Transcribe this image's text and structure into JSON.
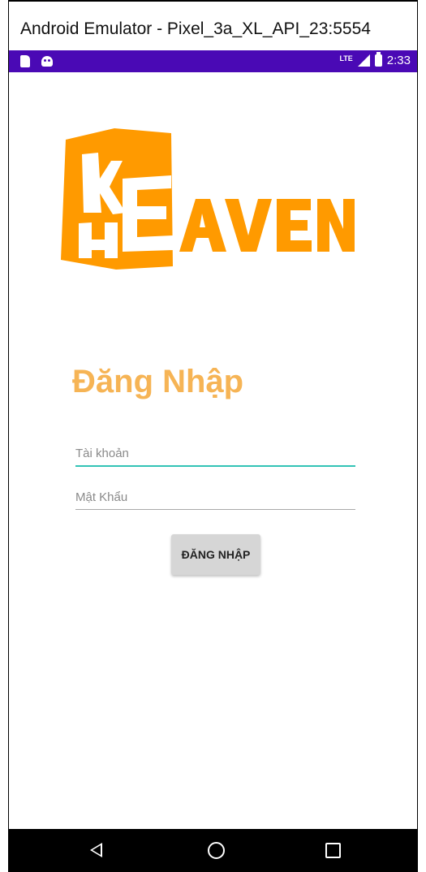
{
  "window": {
    "title": "Android Emulator - Pixel_3a_XL_API_23:5554"
  },
  "status_bar": {
    "time": "2:33",
    "network": "LTE",
    "color": "#4a09b5",
    "icons": [
      "sd-card-icon",
      "android-icon",
      "signal-icon",
      "battery-icon"
    ]
  },
  "logo": {
    "brand_color": "#ff9a00"
  },
  "login": {
    "heading": "Đăng Nhập",
    "heading_color": "#f6b455",
    "username_placeholder": "Tài khoản",
    "password_placeholder": "Mật Khẩu",
    "username_underline_color": "#33c3b6",
    "button_label": "ĐĂNG NHẬP"
  },
  "nav_bar": {
    "icons": [
      "back-icon",
      "home-icon",
      "recents-icon"
    ]
  }
}
